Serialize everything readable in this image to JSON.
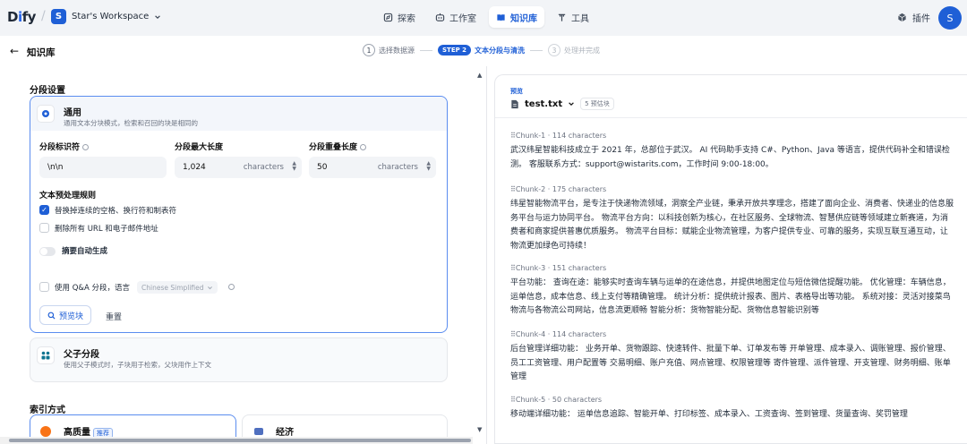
{
  "app": {
    "logo_pre": "D",
    "logo_i": "i",
    "logo_post": "fy",
    "workspace_initial": "S",
    "workspace_name": "Star's Workspace"
  },
  "nav": {
    "items": [
      {
        "label": "探索",
        "icon": "explore-icon"
      },
      {
        "label": "工作室",
        "icon": "studio-icon"
      },
      {
        "label": "知识库",
        "icon": "knowledge-icon",
        "active": true
      },
      {
        "label": "工具",
        "icon": "tools-icon"
      }
    ],
    "plugin_label": "插件",
    "avatar_initial": "S"
  },
  "header": {
    "back_icon": "←",
    "title": "知识库",
    "steps": [
      {
        "num": "1",
        "label": "选择数据源"
      },
      {
        "num": "STEP 2",
        "label": "文本分段与清洗"
      },
      {
        "num": "3",
        "label": "处理并完成"
      }
    ]
  },
  "segmentation": {
    "section_title": "分段设置",
    "general": {
      "title": "通用",
      "desc": "通用文本分块模式，检索和召回的块是相同的",
      "separator_label": "分段标识符",
      "separator_value": "\\n\\n",
      "max_len_label": "分段最大长度",
      "max_len_value": "1,024",
      "max_len_unit": "characters",
      "overlap_label": "分段重叠长度",
      "overlap_value": "50",
      "overlap_unit": "characters",
      "rules_title": "文本预处理规则",
      "rule_replace": "替换掉连续的空格、换行符和制表符",
      "rule_replace_checked": true,
      "rule_delete": "删除所有 URL 和电子邮件地址",
      "rule_delete_checked": false,
      "summary_label": "摘要自动生成",
      "qa_label": "使用 Q&A 分段，语言",
      "qa_language": "Chinese Simplified",
      "preview_button": "预览块",
      "reset_button": "重置"
    },
    "parent": {
      "title": "父子分段",
      "desc": "使用父子模式时，子块用于检索，父块用作上下文"
    }
  },
  "index": {
    "section_title": "索引方式",
    "high_quality": "高质量",
    "recommended_badge": "推荐",
    "economy": "经济"
  },
  "preview": {
    "label": "预览",
    "file_name": "test.txt",
    "chunk_count": "5 预估块",
    "chunks": [
      {
        "head": "Chunk-1 · 114 characters",
        "text": "武汉纬星智能科技成立于 2021 年，总部位于武汉。 AI 代码助手支持 C#、Python、Java 等语言，提供代码补全和错误检测。 客服联系方式：support@wistarits.com，工作时间 9:00-18:00。"
      },
      {
        "head": "Chunk-2 · 175 characters",
        "text": "纬星智能物流平台，是专注于快递物流领域，洞察全产业链，秉承开放共享理念，搭建了面向企业、消费者、快递业的信息服务平台与运力协同平台。 物流平台方向：以科技创新为核心，在社区服务、全球物流、智慧供应链等领域建立新赛道，为消费者和商家提供普惠优质服务。 物流平台目标：赋能企业物流管理，为客户提供专业、可靠的服务，实现互联互通互动，让物流更加绿色可持续！"
      },
      {
        "head": "Chunk-3 · 151 characters",
        "text": "平台功能： 查询在途：能够实时查询车辆与运单的在途信息，并提供地图定位与短信微信提醒功能。 优化管理：车辆信息，运单信息，成本信息、线上支付等精确管理。 统计分析：提供统计报表、图片、表格导出等功能。 系统对接：灵活对接菜鸟物流与各物流公司网站，信息流更顺畅 智能分析：货物智能分配、货物信息智能识别等"
      },
      {
        "head": "Chunk-4 · 114 characters",
        "text": "后台管理详细功能： 业务开单、货物跟踪、快速转件、批量下单、订单发布等 开单管理、成本录入、调账管理、报价管理、员工工资管理、用户配置等 交易明细、账户充值、网点管理、权限管理等 寄件管理、派件管理、开支管理、财务明细、账单管理"
      },
      {
        "head": "Chunk-5 · 50 characters",
        "text": "移动端详细功能： 运单信息追踪、智能开单、打印标签、成本录入、工资查询、签到管理、货量查询、奖罚管理"
      }
    ]
  }
}
